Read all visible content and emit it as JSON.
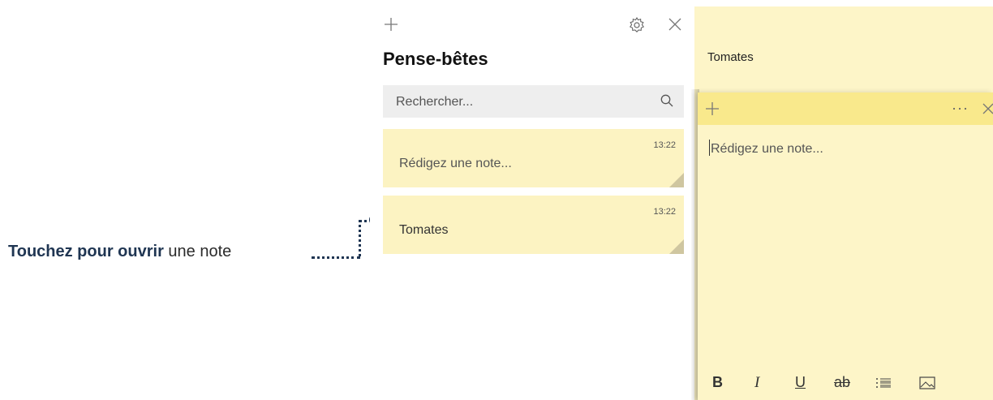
{
  "callout": {
    "bold": "Touchez pour ouvrir",
    "rest": " une note"
  },
  "list_panel": {
    "title": "Pense-bêtes",
    "search_placeholder": "Rechercher...",
    "notes": [
      {
        "time": "13:22",
        "text": "Rédigez une note..."
      },
      {
        "time": "13:22",
        "text": "Tomates"
      }
    ]
  },
  "note_background": {
    "text": "Tomates"
  },
  "note_window": {
    "placeholder": "Rédigez une note...",
    "toolbar": {
      "bold": "B",
      "italic": "I",
      "underline": "U",
      "strike": "ab"
    }
  },
  "colors": {
    "note_yellow": "#fcf3c2",
    "note_header": "#f9e98c",
    "accent": "#1f3552"
  }
}
